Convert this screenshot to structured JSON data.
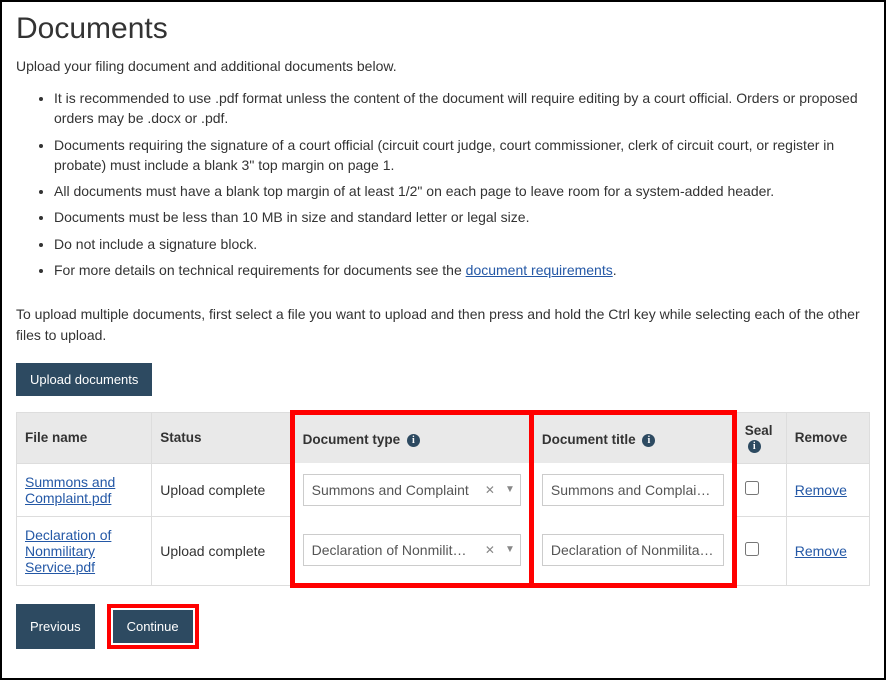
{
  "page": {
    "title": "Documents",
    "intro": "Upload your filing document and additional documents below.",
    "bullets": [
      "It is recommended to use .pdf format unless the content of the document will require editing by a court official. Orders or proposed orders may be .docx or .pdf.",
      "Documents requiring the signature of a court official (circuit court judge, court commissioner, clerk of circuit court, or register in probate) must include a blank 3\" top margin on page 1.",
      "All documents must have a blank top margin of at least 1/2\" on each page to leave room for a system-added header.",
      "Documents must be less than 10 MB in size and standard letter or legal size.",
      "Do not include a signature block."
    ],
    "bullet_link_prefix": "For more details on technical requirements for documents see the ",
    "bullet_link_text": "document requirements",
    "bullet_link_suffix": ".",
    "multi_text": "To upload multiple documents, first select a file you want to upload and then press and hold the Ctrl key while selecting each of the other files to upload.",
    "upload_label": "Upload documents",
    "previous_label": "Previous",
    "continue_label": "Continue"
  },
  "table": {
    "headers": {
      "file_name": "File name",
      "status": "Status",
      "doc_type": "Document type",
      "doc_title": "Document title",
      "seal": "Seal",
      "remove": "Remove"
    },
    "rows": [
      {
        "file_name": "Summons and Complaint.pdf",
        "status": "Upload complete",
        "doc_type": "Summons and Complaint",
        "doc_title": "Summons and Complaint - Da",
        "seal": false,
        "remove": "Remove"
      },
      {
        "file_name": "Declaration of Nonmilitary Service.pdf",
        "status": "Upload complete",
        "doc_type": "Declaration of Nonmilitar…",
        "doc_title": "Declaration of Nonmilitary Ser",
        "seal": false,
        "remove": "Remove"
      }
    ]
  }
}
